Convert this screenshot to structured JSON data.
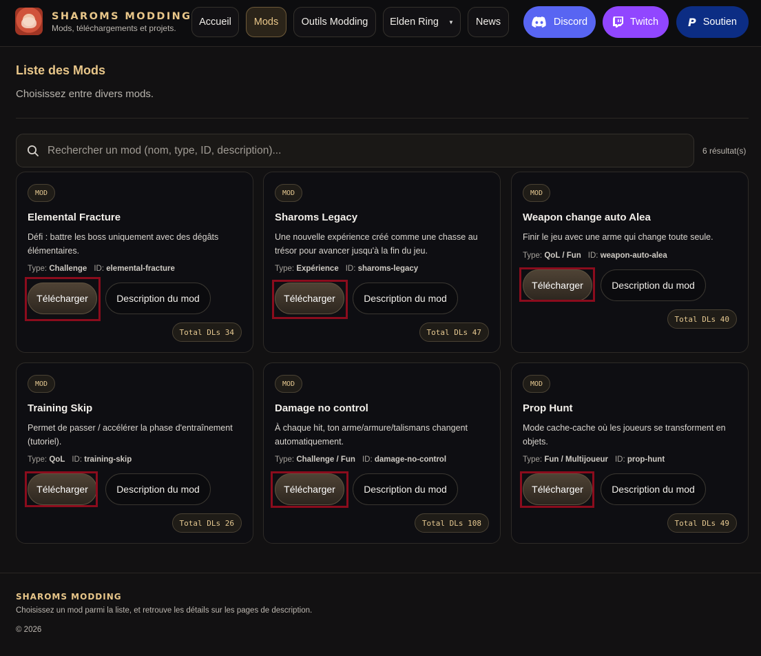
{
  "brand": {
    "name": "SHAROMS MODDING",
    "subtitle": "Mods, téléchargements et projets."
  },
  "nav": [
    {
      "label": "Accueil",
      "active": false
    },
    {
      "label": "Mods",
      "active": true
    },
    {
      "label": "Outils Modding",
      "active": false
    },
    {
      "label": "Elden Ring",
      "active": false,
      "dropdown": true
    },
    {
      "label": "News",
      "active": false
    }
  ],
  "social": [
    {
      "label": "Discord",
      "icon": "discord-icon",
      "color": "#5865f2"
    },
    {
      "label": "Twitch",
      "icon": "twitch-icon",
      "color": "#9146ff"
    },
    {
      "label": "Soutien",
      "icon": "paypal-icon",
      "color": "#0c2d84"
    }
  ],
  "header": {
    "title": "Liste des Mods",
    "subtitle": "Choisissez entre divers mods."
  },
  "search": {
    "placeholder": "Rechercher un mod (nom, type, ID, description)...",
    "value": "",
    "result_count": "6 résultat(s)"
  },
  "labels": {
    "type": "Type:",
    "id": "ID:",
    "download": "Télécharger",
    "description": "Description du mod",
    "total_dls": "Total DLs"
  },
  "mods": [
    {
      "badge": "MOD",
      "title": "Elemental Fracture",
      "description": "Défi : battre les boss uniquement avec des dégâts élémentaires.",
      "type": "Challenge",
      "id": "elemental-fracture",
      "downloads": "34"
    },
    {
      "badge": "MOD",
      "title": "Sharoms Legacy",
      "description": "Une nouvelle expérience créé comme une chasse au trésor pour avancer jusqu'à la fin du jeu.",
      "type": "Expérience",
      "id": "sharoms-legacy",
      "downloads": "47"
    },
    {
      "badge": "MOD",
      "title": "Weapon change auto Alea",
      "description": "Finir le jeu avec une arme qui change toute seule.",
      "type": "QoL / Fun",
      "id": "weapon-auto-alea",
      "downloads": "40"
    },
    {
      "badge": "MOD",
      "title": "Training Skip",
      "description": "Permet de passer / accélérer la phase d'entraînement (tutoriel).",
      "type": "QoL",
      "id": "training-skip",
      "downloads": "26"
    },
    {
      "badge": "MOD",
      "title": "Damage no control",
      "description": "À chaque hit, ton arme/armure/talismans changent automatiquement.",
      "type": "Challenge / Fun",
      "id": "damage-no-control",
      "downloads": "108"
    },
    {
      "badge": "MOD",
      "title": "Prop Hunt",
      "description": "Mode cache-cache où les joueurs se transforment en objets.",
      "type": "Fun / Multijoueur",
      "id": "prop-hunt",
      "downloads": "49"
    }
  ],
  "footer": {
    "name": "SHAROMS MODDING",
    "text": "Choisissez un mod parmi la liste, et retrouve les détails sur les pages de description.",
    "copyright": "© 2026"
  },
  "colors": {
    "accent": "#e8c689",
    "highlight": "#8b0c1d",
    "background": "#121112"
  }
}
